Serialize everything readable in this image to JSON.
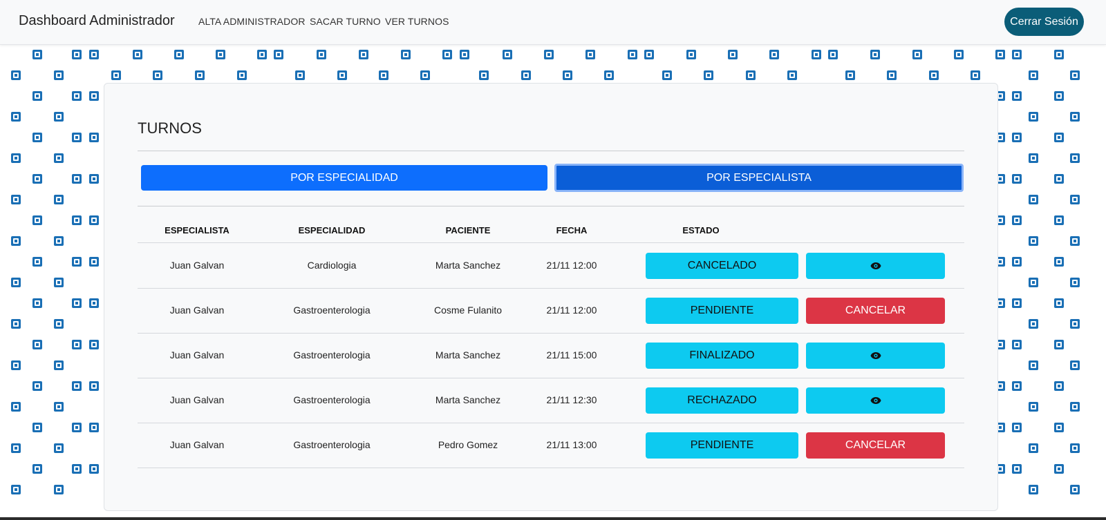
{
  "navbar": {
    "brand": "Dashboard Administrador",
    "links": [
      "ALTA ADMINISTRADOR",
      "SACAR TURNO",
      "VER TURNOS"
    ],
    "logout_label": "Cerrar Sesión"
  },
  "card": {
    "title": "TURNOS",
    "tabs": [
      "POR ESPECIALIDAD",
      "POR ESPECIALISTA"
    ],
    "headers": [
      "ESPECIALISTA",
      "ESPECIALIDAD",
      "PACIENTE",
      "FECHA",
      "ESTADO"
    ],
    "rows": [
      {
        "especialista": "Juan Galvan",
        "especialidad": "Cardiologia",
        "paciente": "Marta Sanchez",
        "fecha": "21/11 12:00",
        "estado": "CANCELADO",
        "action": "eye-icon"
      },
      {
        "especialista": "Juan Galvan",
        "especialidad": "Gastroenterologia",
        "paciente": "Cosme Fulanito",
        "fecha": "21/11 12:00",
        "estado": "PENDIENTE",
        "action": "CANCELAR"
      },
      {
        "especialista": "Juan Galvan",
        "especialidad": "Gastroenterologia",
        "paciente": "Marta Sanchez",
        "fecha": "21/11 15:00",
        "estado": "FINALIZADO",
        "action": "eye-icon"
      },
      {
        "especialista": "Juan Galvan",
        "especialidad": "Gastroenterologia",
        "paciente": "Marta Sanchez",
        "fecha": "21/11 12:30",
        "estado": "RECHAZADO",
        "action": "eye-icon"
      },
      {
        "especialista": "Juan Galvan",
        "especialidad": "Gastroenterologia",
        "paciente": "Pedro Gomez",
        "fecha": "21/11 13:00",
        "estado": "PENDIENTE",
        "action": "CANCELAR"
      }
    ]
  },
  "colors": {
    "primary": "#0d6efd",
    "primary_active": "#0b5ed7",
    "info": "#0dcaf0",
    "danger": "#dc3545",
    "logout": "#0b5d78",
    "pattern": "#1a6fb5"
  }
}
